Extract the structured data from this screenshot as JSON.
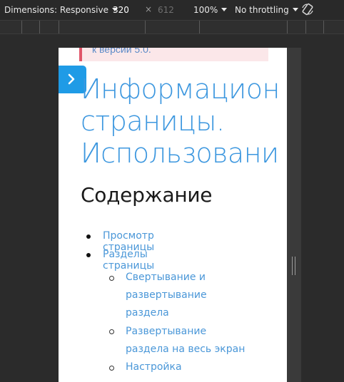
{
  "toolbar": {
    "dimensions_label": "Dimensions: Responsive",
    "width_value": "320",
    "times_sign": "×",
    "height_value": "612",
    "zoom": "100%",
    "throttling": "No throttling"
  },
  "page": {
    "notice_text": "к версии 5.0.",
    "title": "Информацион\nстраницы.\nИспользовани",
    "toc_heading": "Содержание",
    "toc": [
      {
        "label": "Просмотр страницы"
      },
      {
        "label": "Разделы страницы"
      }
    ],
    "subtoc": [
      {
        "label": "Свертывание и\nразвертывание\nраздела"
      },
      {
        "label": "Развертывание\nраздела на весь экран"
      },
      {
        "label": "Настройка"
      }
    ]
  },
  "colors": {
    "link": "#4a97d8",
    "title": "#3c97df",
    "toggle_button": "#1f9be6",
    "notice_border": "#e0566a",
    "notice_bg": "#fbe7e9"
  }
}
